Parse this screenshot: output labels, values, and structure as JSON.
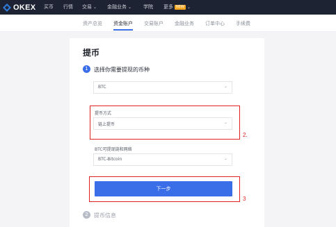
{
  "topnav": {
    "brand": "OKEX",
    "items": [
      "买币",
      "行情",
      "交易",
      "金融业务",
      "学院",
      "更多"
    ],
    "badge": "NEW"
  },
  "subtabs": [
    "资产总览",
    "资金账户",
    "交易账户",
    "金融业务",
    "订单中心",
    "手续费"
  ],
  "page": {
    "title": "提币"
  },
  "steps": [
    {
      "number": "1",
      "label": "选择你需要提现的币种"
    },
    {
      "number": "2",
      "label": "提币信息"
    }
  ],
  "form": {
    "coin_value": "BTC",
    "method_label": "提币方式",
    "method_value": "链上提币",
    "network_label": "BTC可提现链和网络",
    "network_value": "BTC-Bitcoin",
    "next_button": "下一步"
  },
  "annotations": [
    "2.",
    "3"
  ],
  "colors": {
    "accent": "#3a6ee8",
    "nav_bg": "#1e2333",
    "annotation": "#e02020"
  }
}
